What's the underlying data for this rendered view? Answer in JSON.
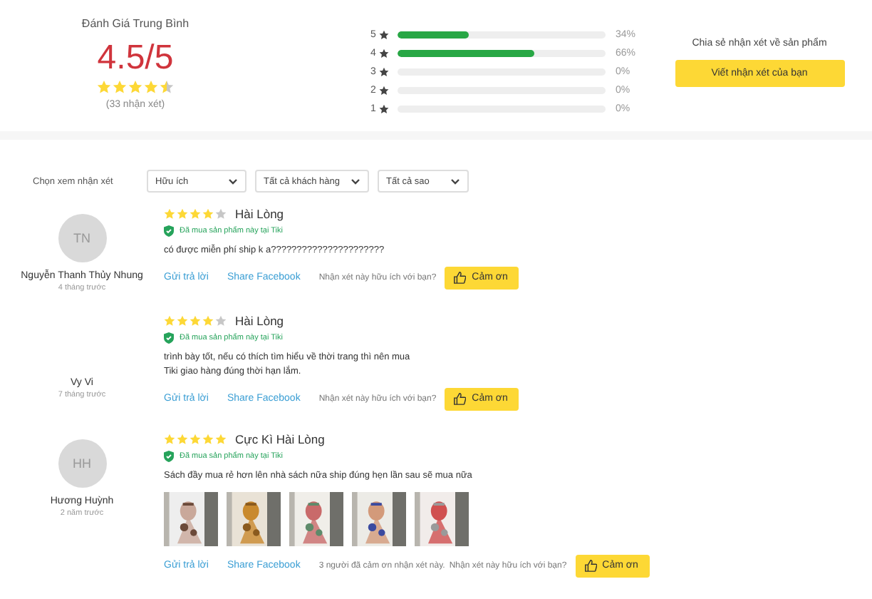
{
  "summary": {
    "title": "Đánh Giá Trung Bình",
    "score": "4.5/5",
    "stars": 4.5,
    "count": "(33 nhận xét)"
  },
  "distribution": [
    {
      "label": "5",
      "level": 0.34,
      "percent": "34%"
    },
    {
      "label": "4",
      "level": 0.66,
      "percent": "66%"
    },
    {
      "label": "3",
      "level": 0,
      "percent": "0%"
    },
    {
      "label": "2",
      "level": 0,
      "percent": "0%"
    },
    {
      "label": "1",
      "level": 0,
      "percent": "0%"
    }
  ],
  "share": {
    "prompt": "Chia sẻ nhận xét về sản phẩm",
    "button": "Viết nhận xét của bạn"
  },
  "filters": {
    "label": "Chọn xem nhận xét",
    "selects": [
      {
        "value": "Hữu ích"
      },
      {
        "value": "Tất cả khách hàng"
      },
      {
        "value": "Tất cả sao"
      }
    ]
  },
  "reviews": [
    {
      "initials": "TN",
      "name": "Nguyễn Thanh Thủy Nhung",
      "time": "4 tháng trước",
      "stars": 4,
      "headline": "Hài Lòng",
      "verified": "Đã mua sản phẩm này tại Tiki",
      "text": [
        "có được miễn phí ship k a??????????????????????"
      ],
      "reply": "Gửi trả lời",
      "share": "Share Facebook",
      "helpful": "Nhận xét này hữu ích với bạn?",
      "thanks": "Cảm ơn"
    },
    {
      "name": "Vy Vi",
      "time": "7 tháng trước",
      "stars": 4,
      "headline": "Hài Lòng",
      "verified": "Đã mua sản phẩm này tại Tiki",
      "text": [
        "trình bày tốt, nếu có thích tìm hiểu về thời trang thì nên mua",
        "Tiki giao hàng đúng thời hạn lắm."
      ],
      "reply": "Gửi trả lời",
      "share": "Share Facebook",
      "helpful": "Nhận xét này hữu ích với bạn?",
      "thanks": "Cảm ơn"
    },
    {
      "initials": "HH",
      "name": "Hương Huỳnh",
      "time": "2 năm trước",
      "stars": 5,
      "headline": "Cực Kì Hài Lòng",
      "verified": "Đã mua sản phẩm này tại Tiki",
      "text": [
        "Sách đầy mua rẻ hơn lên nhà sách nữa ship đúng hẹn lần sau sẽ mua nữa"
      ],
      "photos": [
        {
          "kind": "picture"
        },
        {
          "kind": "picture"
        },
        {
          "kind": "picture"
        },
        {
          "kind": "picture"
        },
        {
          "kind": "picture"
        }
      ],
      "reply": "Gửi trả lời",
      "share": "Share Facebook",
      "thanks_count": "3 người đã cảm ơn nhận xét này.",
      "helpful": "Nhận xét này hữu ích với bạn?",
      "thanks": "Cảm ơn"
    }
  ]
}
